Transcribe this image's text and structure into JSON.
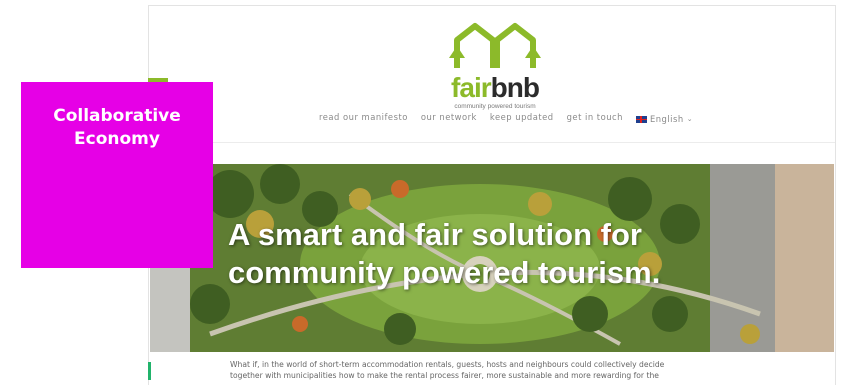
{
  "badge": {
    "line1": "Collaborative",
    "line2": "Economy"
  },
  "site": {
    "logo": {
      "fair": "fair",
      "bnb": "bnb",
      "tagline": "community powered tourism"
    },
    "nav": {
      "items": [
        {
          "label": "read our manifesto"
        },
        {
          "label": "our network"
        },
        {
          "label": "keep updated"
        },
        {
          "label": "get in touch"
        }
      ],
      "language": {
        "label": "English",
        "icon": "uk-flag-icon"
      }
    },
    "hero": {
      "title_line1": "A smart and fair solution for",
      "title_line2": "community powered tourism."
    },
    "intro": {
      "line1": "What if, in the world of short-term accommodation rentals, guests, hosts and neighbours could collectively decide",
      "line2": "together with municipalities how to make the rental process fairer, more sustainable and more rewarding for the"
    },
    "colors": {
      "brand_green": "#8cba2a",
      "badge_magenta": "#e600e6",
      "accent_green": "#21b36b"
    }
  }
}
